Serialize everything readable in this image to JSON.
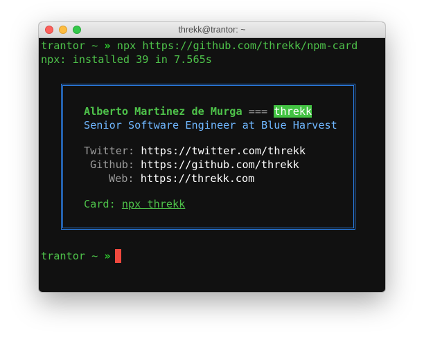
{
  "window": {
    "title": "threkk@trantor: ~"
  },
  "terminal": {
    "prompt_host": "trantor",
    "prompt_tilde": "~",
    "prompt_arrow": "»",
    "command": "npx https://github.com/threkk/npm-card",
    "install_output": "npx: installed 39 in 7.565s",
    "card": {
      "name": "Alberto Martinez de Murga",
      "equals": "===",
      "handle": "threkk",
      "work": "Senior Software Engineer at Blue Harvest",
      "twitter_label": "Twitter:",
      "twitter_url": "https://twitter.com/threkk",
      "github_label": "Github:",
      "github_url": "https://github.com/threkk",
      "web_label": "Web:",
      "web_url": "https://threkk.com",
      "card_label": "Card:",
      "card_command": "npx threkk"
    }
  },
  "colors": {
    "prompt_green": "#4ec24a",
    "highlight_green": "#43c343",
    "subtitle_blue": "#6fb7ff",
    "border_blue": "#2a7be0",
    "cursor_red": "#f0483e",
    "background": "#111111"
  }
}
